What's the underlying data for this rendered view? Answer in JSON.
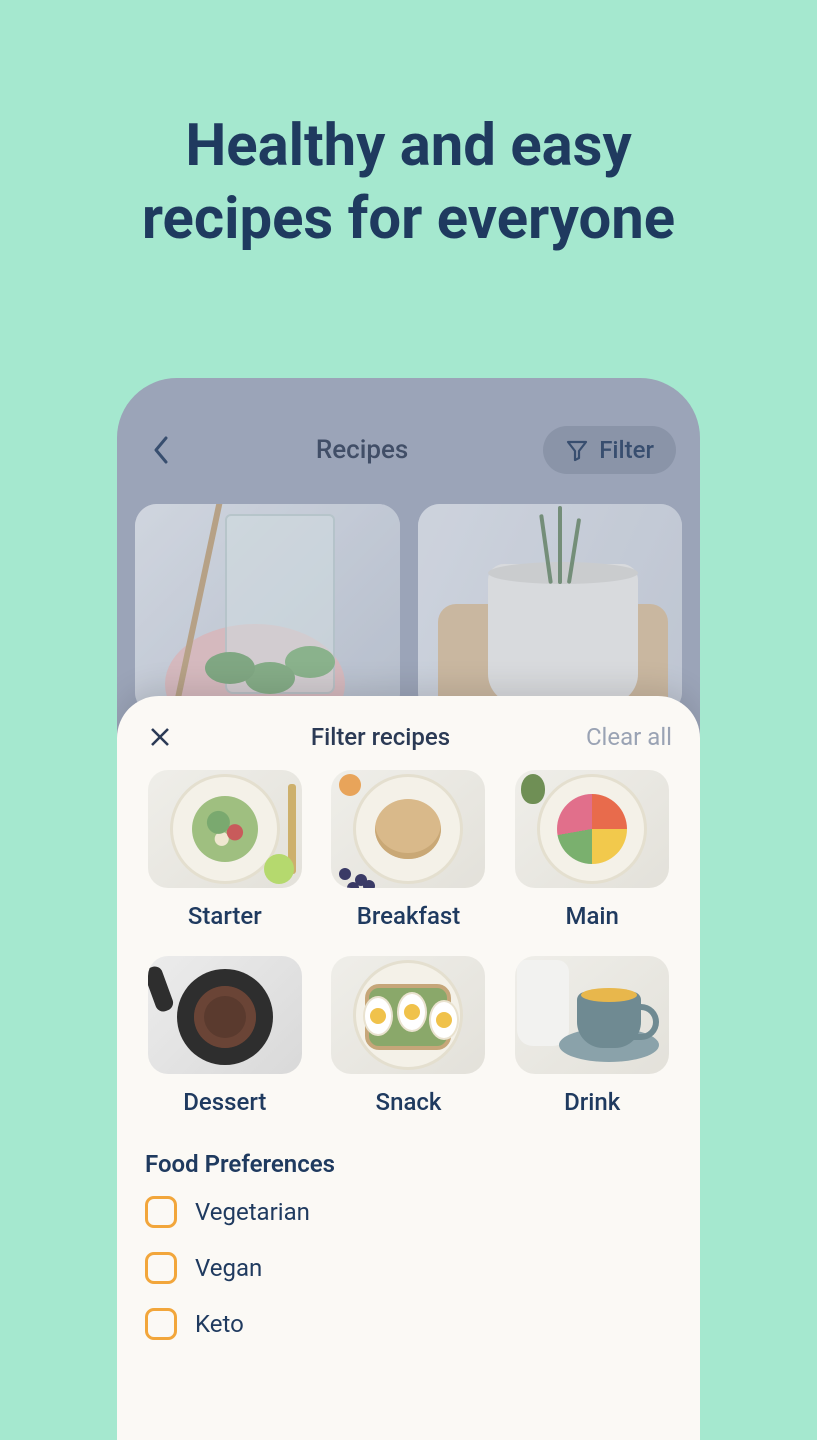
{
  "hero": {
    "line1": "Healthy and easy",
    "line2": "recipes for everyone"
  },
  "app": {
    "header_title": "Recipes",
    "filter_button": "Filter"
  },
  "sheet": {
    "title": "Filter recipes",
    "clear_all": "Clear all",
    "categories": [
      {
        "label": "Starter"
      },
      {
        "label": "Breakfast"
      },
      {
        "label": "Main"
      },
      {
        "label": "Dessert"
      },
      {
        "label": "Snack"
      },
      {
        "label": "Drink"
      }
    ],
    "preferences_title": "Food Preferences",
    "preferences": [
      {
        "label": "Vegetarian",
        "checked": false
      },
      {
        "label": "Vegan",
        "checked": false
      },
      {
        "label": "Keto",
        "checked": false
      }
    ]
  }
}
